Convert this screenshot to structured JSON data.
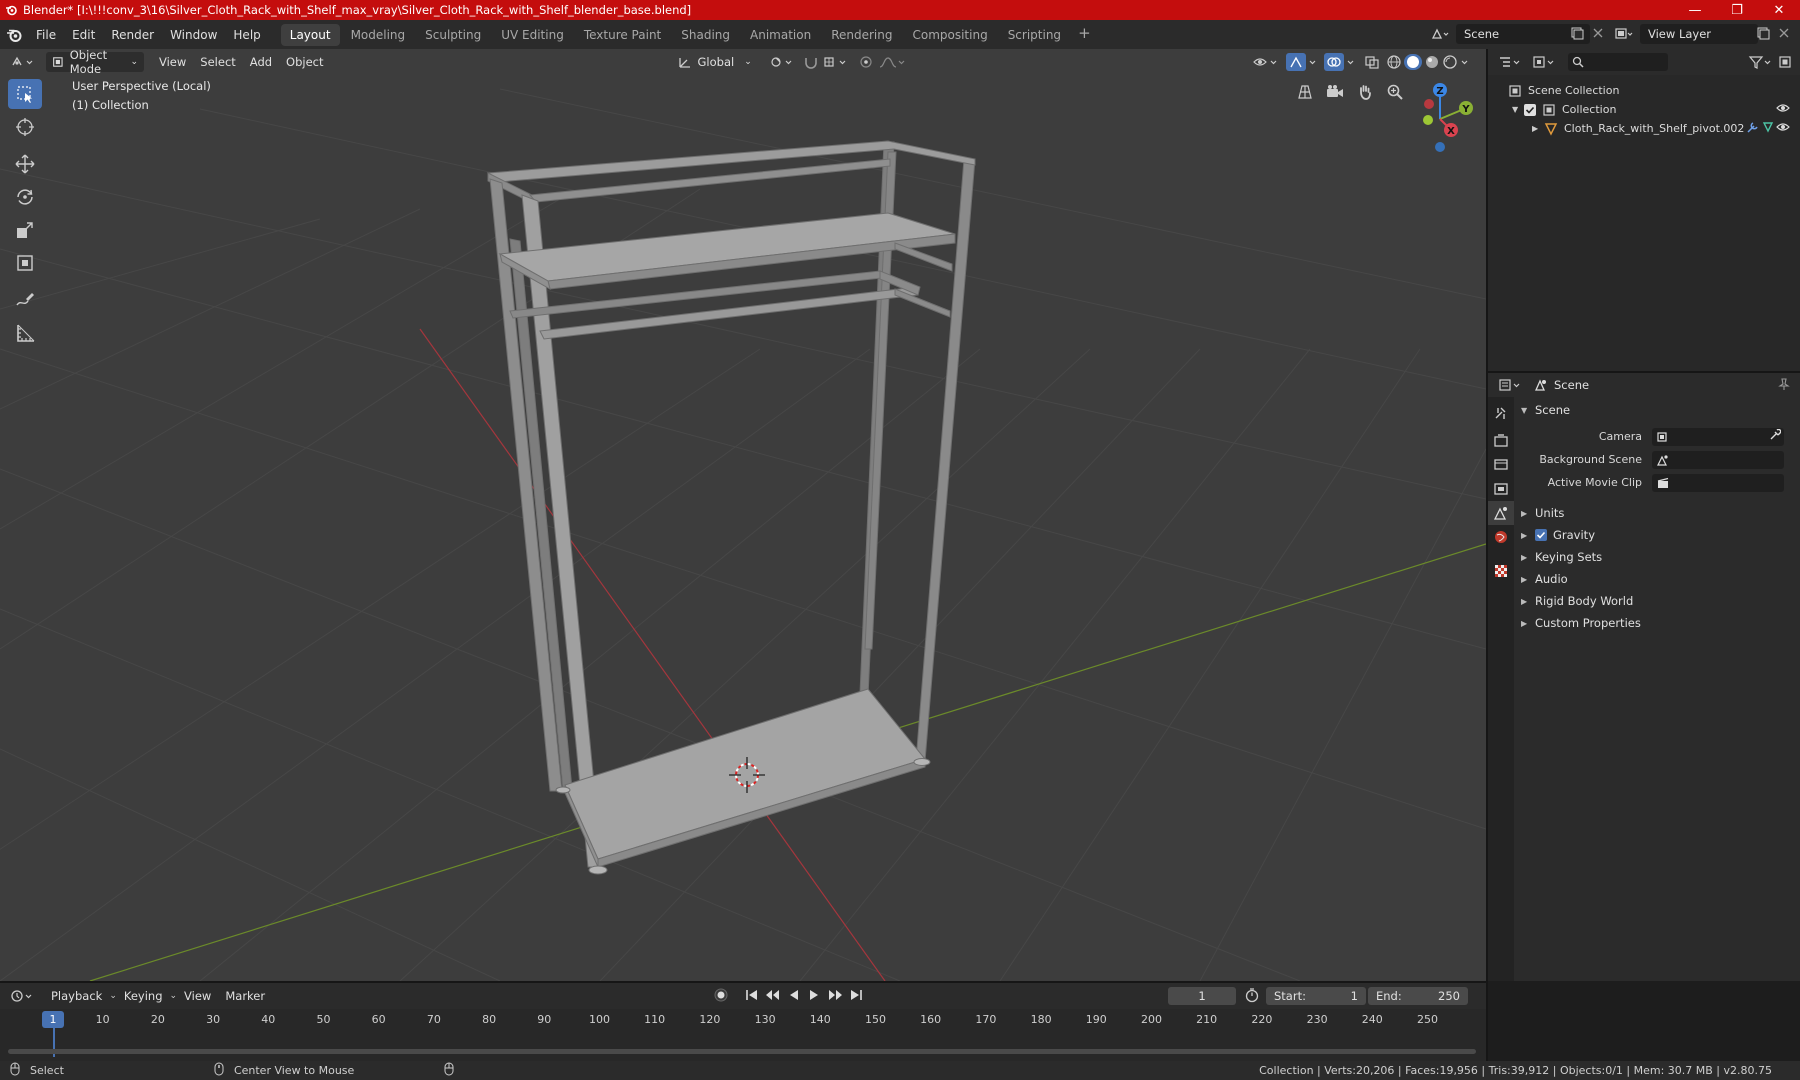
{
  "window": {
    "title": "Blender* [I:\\!!!conv_3\\16\\Silver_Cloth_Rack_with_Shelf_max_vray\\Silver_Cloth_Rack_with_Shelf_blender_base.blend]",
    "controls": [
      "—",
      "❐",
      "✕"
    ]
  },
  "menubar": {
    "menus": [
      "File",
      "Edit",
      "Render",
      "Window",
      "Help"
    ],
    "workspaces": [
      "Layout",
      "Modeling",
      "Sculpting",
      "UV Editing",
      "Texture Paint",
      "Shading",
      "Animation",
      "Rendering",
      "Compositing",
      "Scripting"
    ],
    "active_workspace": "Layout",
    "add_tab": "+",
    "scene": "Scene",
    "view_layer": "View Layer"
  },
  "viewport": {
    "mode": "Object Mode",
    "menus": [
      "View",
      "Select",
      "Add",
      "Object"
    ],
    "orientation": "Global",
    "info_line1": "User Perspective (Local)",
    "info_line2": "(1) Collection",
    "gizmo_axes": [
      "Z",
      "Y",
      "X"
    ],
    "axis_colors": {
      "x": "#d9434f",
      "y": "#8ab034",
      "z": "#3b87e6"
    }
  },
  "tools": [
    "select-box-icon",
    "cursor-icon",
    "move-icon",
    "rotate-icon",
    "scale-icon",
    "transform-icon",
    "annotate-icon",
    "measure-icon"
  ],
  "outliner": {
    "root": "Scene Collection",
    "collection": "Collection",
    "object": "Cloth_Rack_with_Shelf_pivot.002"
  },
  "properties": {
    "context": "Scene",
    "panel_title": "Scene",
    "fields": [
      {
        "label": "Camera",
        "value": ""
      },
      {
        "label": "Background Scene",
        "value": ""
      },
      {
        "label": "Active Movie Clip",
        "value": ""
      }
    ],
    "subpanels": [
      "Units",
      "Gravity",
      "Keying Sets",
      "Audio",
      "Rigid Body World",
      "Custom Properties"
    ],
    "gravity_checked": true
  },
  "timeline": {
    "menus": [
      "Playback",
      "Keying",
      "View",
      "Marker"
    ],
    "current_frame": "1",
    "start_label": "Start:",
    "start": "1",
    "end_label": "End:",
    "end": "250",
    "ruler": [
      "10",
      "20",
      "30",
      "40",
      "50",
      "60",
      "70",
      "80",
      "90",
      "100",
      "110",
      "120",
      "130",
      "140",
      "150",
      "160",
      "170",
      "180",
      "190",
      "200",
      "210",
      "220",
      "230",
      "240",
      "250"
    ]
  },
  "statusbar": {
    "left_action": "Select",
    "middle_action": "Center View to Mouse",
    "stats": "Collection | Verts:20,206 | Faces:19,956 | Tris:39,912 | Objects:0/1 | Mem: 30.7 MB | v2.80.75"
  }
}
